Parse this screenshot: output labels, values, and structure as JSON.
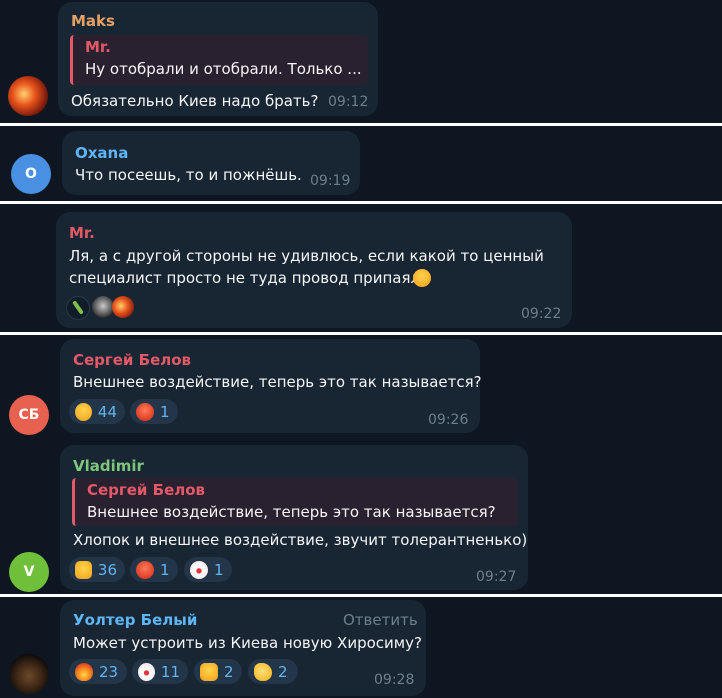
{
  "messages": [
    {
      "sender": "Maks",
      "sender_color": "#e5a064",
      "quote": {
        "name": "Mr.",
        "text": "Ну отобрали и отобрали. Только ..."
      },
      "text": "Обязательно Киев надо брать?",
      "time": "09:12",
      "avatar_icon": "fire-avatar-icon"
    },
    {
      "sender": "Oxana",
      "sender_color": "#5eb5f7",
      "text": "Что посеешь, то и пожнёшь.",
      "time": "09:19",
      "avatar_initials": "O",
      "avatar_color": "#4a90e2"
    },
    {
      "sender": "Mr.",
      "sender_color": "#e35967",
      "text_lines": [
        "Ля, а с другой стороны не удивлюсь, если какой то ценный",
        "специалист просто не туда провод припаял"
      ],
      "text_emoji": "rofl-emoji-icon",
      "reactor_avatars": [
        "bottle-avatar-icon",
        "helmet-avatar-icon",
        "fire-avatar-icon"
      ],
      "time": "09:22"
    },
    {
      "sender": "Сергей Белов",
      "sender_color": "#e35967",
      "text": "Внешнее воздействие, теперь это так называется?",
      "reactions": [
        {
          "icon": "grin-emoji-icon",
          "count": "44"
        },
        {
          "icon": "angry-emoji-icon",
          "count": "1"
        }
      ],
      "time": "09:26",
      "avatar_initials": "СБ",
      "avatar_color": "#e8604f"
    },
    {
      "sender": "Vladimir",
      "sender_color": "#7ec77a",
      "quote": {
        "name": "Сергей Белов",
        "text": "Внешнее воздействие, теперь это так называется?"
      },
      "text": "Хлопок и внешнее воздействие, звучит толерантненько)",
      "reactions": [
        {
          "icon": "thumbs-up-emoji-icon",
          "count": "36"
        },
        {
          "icon": "angry-emoji-icon",
          "count": "1"
        },
        {
          "icon": "clown-emoji-icon",
          "count": "1"
        }
      ],
      "time": "09:27",
      "avatar_initials": "V",
      "avatar_color": "#6fbf3b"
    },
    {
      "sender": "Уолтер Белый",
      "sender_color": "#5eb5f7",
      "reply_label": "Ответить",
      "text": "Может устроить из Киева новую Хиросиму?",
      "reactions": [
        {
          "icon": "fire-emoji-icon",
          "count": "23"
        },
        {
          "icon": "clown-emoji-icon",
          "count": "11"
        },
        {
          "icon": "thumbs-up-emoji-icon",
          "count": "2"
        },
        {
          "icon": "clap-emoji-icon",
          "count": "2"
        }
      ],
      "time": "09:28",
      "avatar_icon": "bear-avatar-icon"
    }
  ]
}
